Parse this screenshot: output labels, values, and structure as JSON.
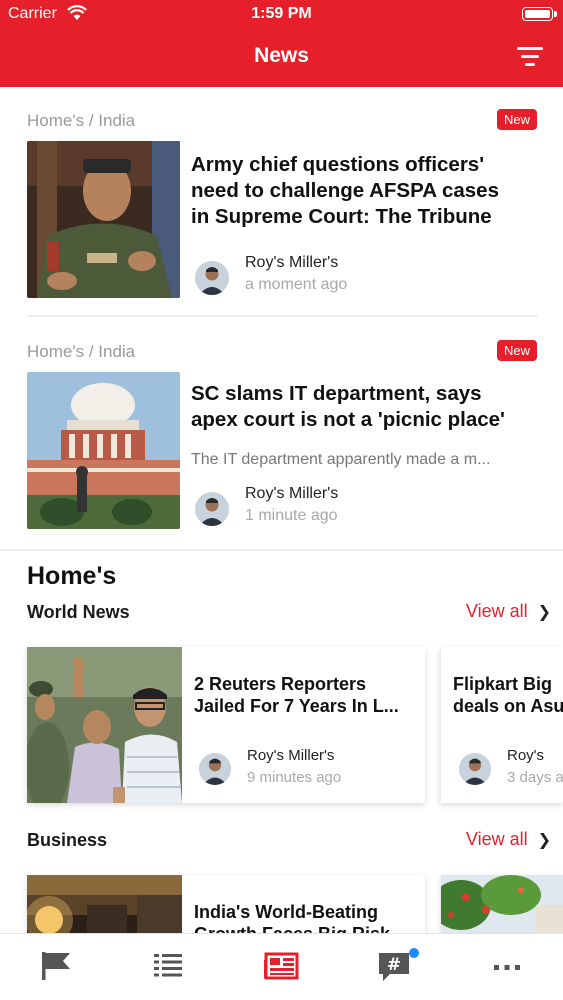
{
  "status_bar": {
    "carrier": "Carrier",
    "time": "1:59 PM"
  },
  "nav": {
    "title": "News",
    "filter_icon": "filter-icon"
  },
  "articles": [
    {
      "breadcrumb": "Home's / India",
      "badge": "New",
      "headline_lines": [
        "Army chief questions officers'",
        "need to challenge AFSPA cases",
        "in Supreme Court: The Tribune"
      ],
      "excerpt": "",
      "author": "Roy's Miller's",
      "time": "a moment ago"
    },
    {
      "breadcrumb": "Home's / India",
      "badge": "New",
      "headline_lines": [
        "SC slams IT department, says",
        "apex court is not a 'picnic place'"
      ],
      "excerpt": "The IT department apparently made a m...",
      "author": "Roy's Miller's",
      "time": "1 minute ago"
    }
  ],
  "home_section": {
    "title": "Home's",
    "categories": [
      {
        "name": "World News",
        "view_all": "View all",
        "cards": [
          {
            "title_lines": [
              "2 Reuters Reporters",
              "Jailed For 7 Years In L..."
            ],
            "author": "Roy's Miller's",
            "time": "9 minutes ago"
          },
          {
            "title_lines": [
              "Flipkart Big",
              "deals on Asu"
            ],
            "author": "Roy's",
            "time": "3 days a"
          }
        ]
      },
      {
        "name": "Business",
        "view_all": "View all",
        "cards": [
          {
            "title_lines": [
              "India's World-Beating",
              "Growth Faces Big Risk"
            ]
          },
          {
            "title_lines": []
          }
        ]
      }
    ]
  },
  "tabbar": {
    "tabs": [
      {
        "icon": "flag-icon",
        "active": false
      },
      {
        "icon": "list-icon",
        "active": false
      },
      {
        "icon": "newspaper-icon",
        "active": true
      },
      {
        "icon": "hashtag-chat-icon",
        "active": false,
        "notification": true
      },
      {
        "icon": "more-icon",
        "active": false
      }
    ]
  },
  "colors": {
    "accent": "#e5202a",
    "inactive_icon": "#555555",
    "notification_dot": "#1a8cff"
  }
}
